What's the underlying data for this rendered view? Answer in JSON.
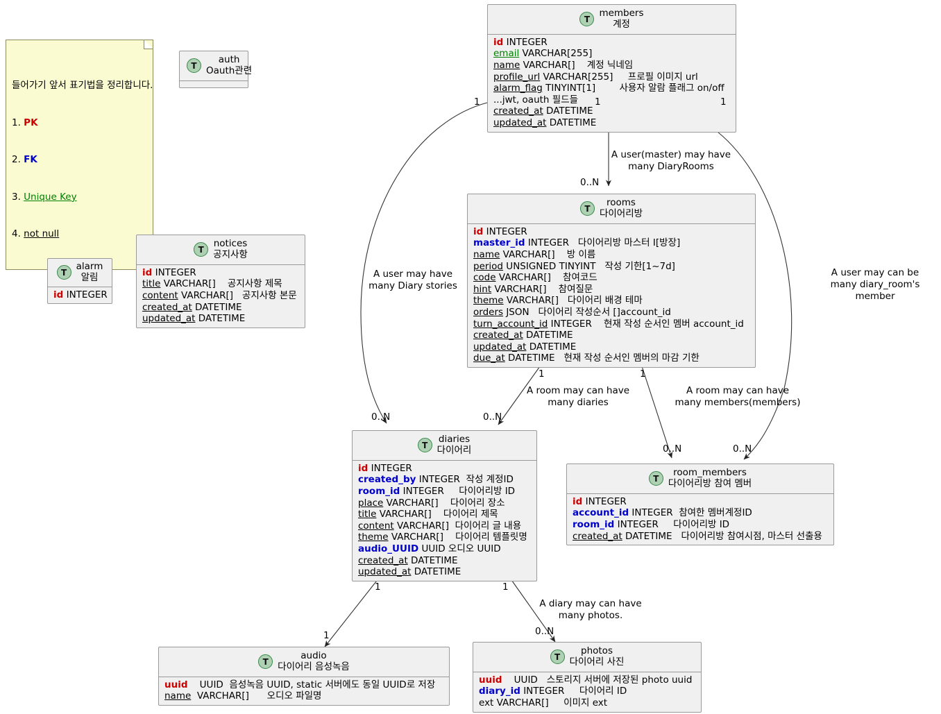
{
  "diagram": {
    "title": "ERD",
    "background": "#ffffff",
    "entity_fill": "#f0f0f0",
    "entity_border": "#999999",
    "note_fill": "#FBFBD2",
    "note_border": "#8a8a5c",
    "icon_fill": "#ADD1B2",
    "pk_color": "#CC0000",
    "fk_color": "#0000CC",
    "uk_color": "#008000"
  },
  "note": {
    "name": "legend-note",
    "lines": [
      {
        "text": "들어가기 앞서 표기법을 정리합니다.",
        "style": "plain"
      },
      {
        "prefix": "1. ",
        "text": "PK",
        "style": "pk"
      },
      {
        "prefix": "2. ",
        "text": "FK",
        "style": "fk"
      },
      {
        "prefix": "3. ",
        "text": "Unique Key",
        "style": "uk"
      },
      {
        "prefix": "4. ",
        "text": "not null",
        "style": "nn"
      }
    ]
  },
  "entities": [
    {
      "id": "auth",
      "icon": "table-icon",
      "name": "auth",
      "sub": "Oauth관련",
      "fields": []
    },
    {
      "id": "members",
      "icon": "table-icon",
      "name": "members",
      "sub": "계정",
      "fields": [
        {
          "name": "id",
          "style": "pk",
          "rest": " INTEGER"
        },
        {
          "name": "email",
          "style": "uk",
          "rest": " VARCHAR[255]"
        },
        {
          "name": "name",
          "style": "nn",
          "rest": " VARCHAR[]    계정 닉네임"
        },
        {
          "name": "profile_url",
          "style": "nn",
          "rest": " VARCHAR[255]     프로필 이미지 url"
        },
        {
          "name": "alarm_flag",
          "style": "nn",
          "rest": " TINYINT[1]        사용자 알람 플래그 on/off"
        },
        {
          "name": "...jwt, oauth 필드들",
          "style": "plain",
          "rest": ""
        },
        {
          "name": "created_at",
          "style": "nn",
          "rest": " DATETIME"
        },
        {
          "name": "updated_at",
          "style": "nn",
          "rest": " DATETIME"
        }
      ]
    },
    {
      "id": "alarm",
      "icon": "table-icon",
      "name": "alarm",
      "sub": "알림",
      "fields": [
        {
          "name": "id",
          "style": "pk",
          "rest": " INTEGER"
        }
      ]
    },
    {
      "id": "notices",
      "icon": "table-icon",
      "name": "notices",
      "sub": "공지사항",
      "fields": [
        {
          "name": "id",
          "style": "pk",
          "rest": " INTEGER"
        },
        {
          "name": "title",
          "style": "nn",
          "rest": " VARCHAR[]    공지사항 제목"
        },
        {
          "name": "content",
          "style": "nn",
          "rest": " VARCHAR[]   공지사항 본문"
        },
        {
          "name": "created_at",
          "style": "nn",
          "rest": " DATETIME"
        },
        {
          "name": "updated_at",
          "style": "nn",
          "rest": " DATETIME"
        }
      ]
    },
    {
      "id": "rooms",
      "icon": "table-icon",
      "name": "rooms",
      "sub": "다이어리방",
      "fields": [
        {
          "name": "id",
          "style": "pk",
          "rest": " INTEGER"
        },
        {
          "name": "master_id",
          "style": "fk",
          "rest": " INTEGER   다이어리방 마스터 I[방장]"
        },
        {
          "name": "name",
          "style": "nn",
          "rest": " VARCHAR[]    방 이름"
        },
        {
          "name": "period",
          "style": "nn",
          "rest": " UNSIGNED TINYINT   작성 기한[1~7d]"
        },
        {
          "name": "code",
          "style": "nn",
          "rest": " VARCHAR[]    참여코드"
        },
        {
          "name": "hint",
          "style": "nn",
          "rest": " VARCHAR[]    참여질문"
        },
        {
          "name": "theme",
          "style": "nn",
          "rest": " VARCHAR[]   다이어리 배경 테마"
        },
        {
          "name": "orders",
          "style": "nn",
          "rest": " JSON   다이어리 작성순서 []account_id"
        },
        {
          "name": "turn_account_id",
          "style": "nn",
          "rest": " INTEGER    현재 작성 순서인 멤버 account_id"
        },
        {
          "name": "created_at",
          "style": "nn",
          "rest": " DATETIME"
        },
        {
          "name": "updated_at",
          "style": "nn",
          "rest": " DATETIME"
        },
        {
          "name": "due_at",
          "style": "nn",
          "rest": " DATETIME   현재 작성 순서인 멤버의 마감 기한"
        }
      ]
    },
    {
      "id": "diaries",
      "icon": "table-icon",
      "name": "diaries",
      "sub": "다이어리",
      "fields": [
        {
          "name": "id",
          "style": "pk",
          "rest": " INTEGER"
        },
        {
          "name": "created_by",
          "style": "fk",
          "rest": " INTEGER  작성 계정ID"
        },
        {
          "name": "room_id",
          "style": "fk",
          "rest": " INTEGER     다이어리방 ID"
        },
        {
          "name": "place",
          "style": "nn",
          "rest": " VARCHAR[]    다이어리 장소"
        },
        {
          "name": "title",
          "style": "nn",
          "rest": " VARCHAR[]    다이어리 제목"
        },
        {
          "name": "content",
          "style": "nn",
          "rest": " VARCHAR[]  다이어리 글 내용"
        },
        {
          "name": "theme",
          "style": "nn",
          "rest": " VARCHAR[]    다이어리 템플릿명"
        },
        {
          "name": "audio_UUID",
          "style": "fk",
          "rest": " UUID 오디오 UUID"
        },
        {
          "name": "created_at",
          "style": "nn",
          "rest": " DATETIME"
        },
        {
          "name": "updated_at",
          "style": "nn",
          "rest": " DATETIME"
        }
      ]
    },
    {
      "id": "room_members",
      "icon": "table-icon",
      "name": "room_members",
      "sub": "다이어리방 참여 멤버",
      "fields": [
        {
          "name": "id",
          "style": "pk",
          "rest": " INTEGER"
        },
        {
          "name": "account_id",
          "style": "fk",
          "rest": " INTEGER  참여한 멤버계정ID"
        },
        {
          "name": "room_id",
          "style": "fk",
          "rest": " INTEGER     다이어리방 ID"
        },
        {
          "name": "created_at",
          "style": "nn",
          "rest": " DATETIME   다이어리방 참여시점, 마스터 선출용"
        }
      ]
    },
    {
      "id": "audio",
      "icon": "table-icon",
      "name": "audio",
      "sub": "다이어리 음성녹음",
      "fields": [
        {
          "name": "uuid",
          "style": "pk",
          "rest": "    UUID  음성녹음 UUID, static 서버에도 동일 UUID로 저장"
        },
        {
          "name": "name",
          "style": "nn",
          "rest": "  VARCHAR[]      오디오 파일명"
        }
      ]
    },
    {
      "id": "photos",
      "icon": "table-icon",
      "name": "photos",
      "sub": "다이어리 사진",
      "fields": [
        {
          "name": "uuid",
          "style": "pk",
          "rest": "    UUID   스토리지 서버에 저장된 photo uuid"
        },
        {
          "name": "diary_id",
          "style": "fk",
          "rest": " INTEGER     다이어리 ID"
        },
        {
          "name": "ext",
          "style": "plain",
          "rest": " VARCHAR[]     이미지 ext"
        }
      ]
    }
  ],
  "relationships": [
    {
      "id": "members-rooms",
      "label": "A user(master) may have\nmany DiaryRooms",
      "from_mult": "1",
      "to_mult": "0..N"
    },
    {
      "id": "members-diaries",
      "label": "A user may have\nmany Diary stories",
      "from_mult": "1",
      "to_mult": "0..N"
    },
    {
      "id": "members-room_members",
      "label": "A user may can be\nmany diary_room's member",
      "from_mult": "1",
      "to_mult": "0..N"
    },
    {
      "id": "rooms-diaries",
      "label": "A room may can have\nmany diaries",
      "from_mult": "1",
      "to_mult": "0..N"
    },
    {
      "id": "rooms-room_members",
      "label": "A room may can have\nmany members(members)",
      "from_mult": "1",
      "to_mult": "0..N"
    },
    {
      "id": "diaries-audio",
      "label": "",
      "from_mult": "1",
      "to_mult": "1"
    },
    {
      "id": "diaries-photos",
      "label": "A diary may can have\nmany photos.",
      "from_mult": "1",
      "to_mult": "0..N"
    }
  ]
}
